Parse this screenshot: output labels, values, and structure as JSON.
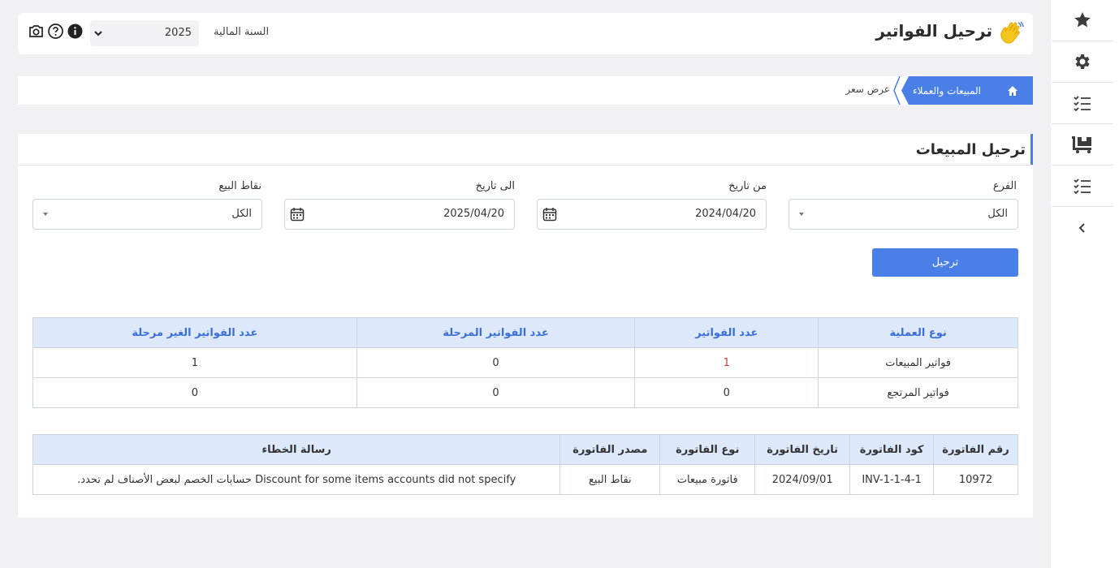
{
  "header": {
    "title": "ترحيل الفواتير",
    "fiscal_year_label": "السنة المالية",
    "fiscal_year_value": "2025"
  },
  "breadcrumb": {
    "section": "المبيعات والعملاء",
    "current": "عرض سعر"
  },
  "section": {
    "title": "ترحيل المبيعات"
  },
  "filters": {
    "branch_label": "الفرع",
    "branch_value": "الكل",
    "from_label": "من تاريخ",
    "from_value": "2024/04/20",
    "to_label": "الى تاريخ",
    "to_value": "2025/04/20",
    "pos_label": "نقاط البيع",
    "pos_value": "الكل"
  },
  "post_button": "ترحيل",
  "summary_table": {
    "headers": [
      "نوع العملية",
      "عدد الفواتير",
      "عدد الفواتير المرحلة",
      "عدد الفواتير الغير مرحلة"
    ],
    "rows": [
      [
        "فواتير المبيعات",
        "1",
        "0",
        "1"
      ],
      [
        "فواتير المرتجع",
        "0",
        "0",
        "0"
      ]
    ]
  },
  "errors_table": {
    "headers": [
      "رقم الفاتورة",
      "كود الفاتورة",
      "تاريخ الفاتورة",
      "نوع الفاتورة",
      "مصدر الفاتورة",
      "رسالة الخطاء"
    ],
    "rows": [
      [
        "10972",
        "INV-1-1-4-1",
        "2024/09/01",
        "فاتورة مبيعات",
        "نقاط البيع",
        "Discount for some items accounts did not specify حسابات الخصم لبعض الأصناف لم تحدد."
      ]
    ]
  },
  "icons": {
    "sidebar": [
      "star-icon",
      "gear-icon",
      "checklist-icon",
      "cart-icon",
      "checklist-icon",
      "chevron-left-icon"
    ],
    "header": [
      "camera-icon",
      "help-icon",
      "info-icon",
      "chevron-down-icon",
      "waving-hand-icon"
    ],
    "breadcrumb_home": "home-icon"
  },
  "colors": {
    "accent": "#4a7fe8",
    "table_header_bg": "#dde8fb",
    "highlight_red": "#d23b3b"
  }
}
